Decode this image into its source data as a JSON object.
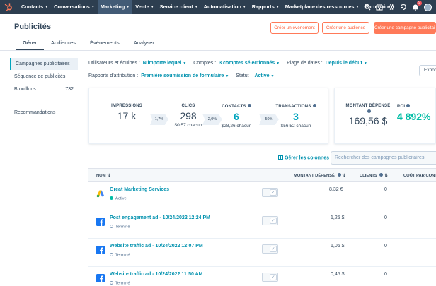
{
  "nav": {
    "items": [
      {
        "label": "Contacts",
        "active": false
      },
      {
        "label": "Conversations",
        "active": false
      },
      {
        "label": "Marketing",
        "active": true
      },
      {
        "label": "Vente",
        "active": false
      },
      {
        "label": "Service client",
        "active": false
      },
      {
        "label": "Automatisation",
        "active": false
      },
      {
        "label": "Rapports",
        "active": false
      },
      {
        "label": "Marketplace des ressources",
        "active": false
      },
      {
        "label": "Partenaire",
        "active": false
      }
    ],
    "notification_count": "9",
    "icons": [
      "search-icon",
      "marketplace-icon",
      "settings-icon",
      "notifications-icon",
      "avatar"
    ]
  },
  "header": {
    "title": "Publicités",
    "buttons": {
      "create_event": "Créer un événement",
      "create_audience": "Créer une audience",
      "create_campaign": "Créer une campagne publicitaire"
    },
    "tabs": [
      {
        "label": "Gérer",
        "active": true
      },
      {
        "label": "Audiences",
        "active": false
      },
      {
        "label": "Événements",
        "active": false
      },
      {
        "label": "Analyser",
        "active": false
      }
    ]
  },
  "sidebar": {
    "items": [
      {
        "label": "Campagnes publicitaires",
        "active": true,
        "count": ""
      },
      {
        "label": "Séquence de publicités",
        "active": false,
        "count": ""
      },
      {
        "label": "Brouillons",
        "active": false,
        "count": "732"
      },
      {
        "label": "Recommandations",
        "active": false,
        "count": ""
      }
    ]
  },
  "filters": {
    "users_label": "Utilisateurs et équipes :",
    "users_value": "N'importe lequel",
    "accounts_label": "Comptes :",
    "accounts_value": "3 comptes sélectionnés",
    "date_label": "Plage de dates :",
    "date_value": "Depuis le début",
    "attribution_label": "Rapports d'attribution :",
    "attribution_value": "Première soumission de formulaire",
    "status_label": "Statut :",
    "status_value": "Active",
    "export_label": "Export"
  },
  "kpis": {
    "impressions": {
      "label": "IMPRESSIONS",
      "value": "17 k"
    },
    "rate1": "1,7%",
    "clicks": {
      "label": "CLICS",
      "value": "298",
      "sub": "$0,57 chacun"
    },
    "rate2": "2,0%",
    "contacts": {
      "label": "CONTACTS",
      "value": "6",
      "sub": "$28,26 chacun"
    },
    "rate3": "50%",
    "transactions": {
      "label": "TRANSACTIONS",
      "value": "3",
      "sub": "$56,52 chacun"
    },
    "spent": {
      "label": "MONTANT DÉPENSÉ",
      "value": "169,56 $"
    },
    "roi": {
      "label": "ROI",
      "value": "4 892%"
    }
  },
  "table": {
    "manage_columns": "Gérer les colonnes",
    "search_placeholder": "Rechercher des campagnes publicitaires",
    "columns": {
      "name": "NOM",
      "spent": "MONTANT DÉPENSÉ",
      "clients": "CLIENTS",
      "cost": "COÛT PAR CONT"
    },
    "rows": [
      {
        "name": "Great Marketing Services",
        "status": "Active",
        "platform": "google",
        "spent": "8,32 €",
        "clients": "0"
      },
      {
        "name": "Post engagement ad - 10/24/2022 12:24 PM",
        "status": "Terminé",
        "platform": "facebook",
        "spent": "1,25 $",
        "clients": "0"
      },
      {
        "name": "Website traffic ad - 10/24/2022 12:07 PM",
        "status": "Terminé",
        "platform": "facebook",
        "spent": "1,06 $",
        "clients": "0"
      },
      {
        "name": "Website traffic ad - 10/24/2022 11:50 AM",
        "status": "Terminé",
        "platform": "facebook",
        "spent": "0,45 $",
        "clients": "0"
      }
    ]
  },
  "colors": {
    "nav_bg": "#2d3e50",
    "accent": "#ff7a59",
    "link": "#0091ae",
    "success": "#00bda5"
  }
}
